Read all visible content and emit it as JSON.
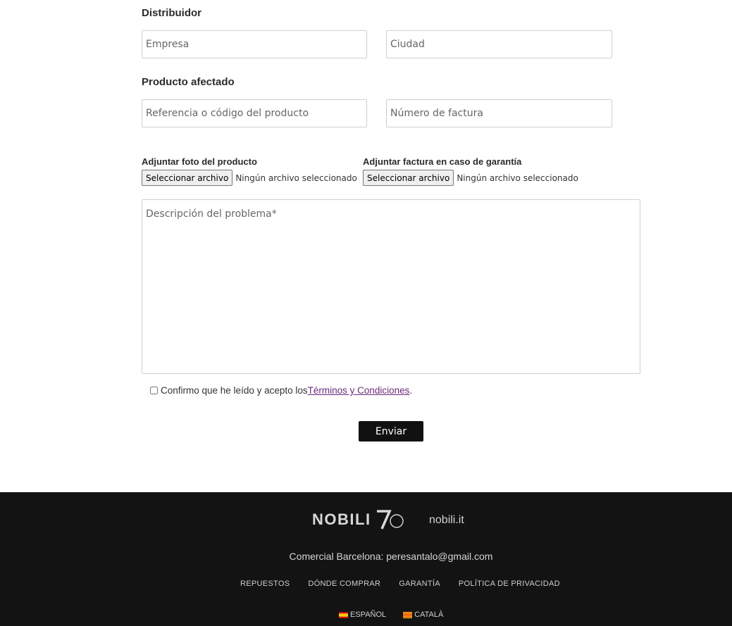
{
  "form": {
    "distributor_title": "Distribuidor",
    "company_placeholder": "Empresa",
    "city_placeholder": "Ciudad",
    "product_title": "Producto afectado",
    "reference_placeholder": "Referencia o código del producto",
    "invoice_placeholder": "Número de factura",
    "photo_upload": {
      "label": "Adjuntar foto del producto",
      "button": "Seleccionar archivo",
      "status": "Ningún archivo seleccionado"
    },
    "invoice_upload": {
      "label": "Adjuntar factura en caso de garantía",
      "button": "Seleccionar archivo",
      "status": "Ningún archivo seleccionado"
    },
    "description_placeholder": "Descripción del problema*",
    "confirm_text": "Confirmo que he leído y acepto los ",
    "terms_link": "Términos y Condiciones",
    "confirm_end": ".",
    "submit_label": "Enviar"
  },
  "footer": {
    "logo_text": "NOBILI",
    "logo_number": "7",
    "site_link": "nobili.it",
    "contact": "Comercial Barcelona: peresantalo@gmail.com",
    "nav": [
      "REPUESTOS",
      "DÓNDE COMPRAR",
      "GARANTÍA",
      "POLÍTICA DE PRIVACIDAD"
    ],
    "languages": [
      {
        "label": "ESPAÑOL",
        "flag": "spain-flag-icon"
      },
      {
        "label": "CATALÀ",
        "flag": "catalonia-flag-icon"
      }
    ],
    "colors": {
      "background": "#131313",
      "text": "#cfcfcf"
    }
  },
  "colors": {
    "link": "#6b2a7a",
    "button": "#111111"
  }
}
